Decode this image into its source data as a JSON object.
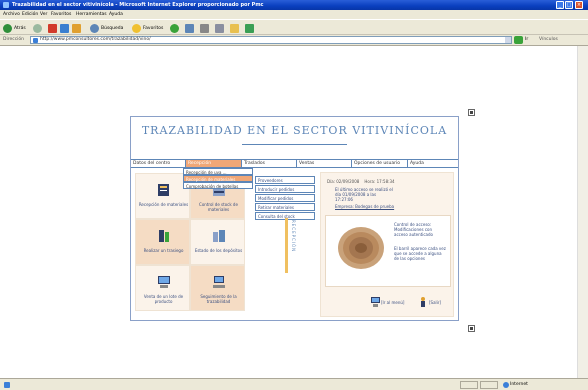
{
  "window": {
    "title": "Trazabilidad en el sector vitivinícola - Microsoft Internet Explorer proporcionado por Pmc",
    "controls": {
      "minimize": "_",
      "maximize": "□",
      "close": "×"
    }
  },
  "menu": [
    "Archivo",
    "Edición",
    "Ver",
    "Favoritos",
    "Herramientas",
    "Ayuda"
  ],
  "toolbar": {
    "back": "Atrás",
    "search": "Búsqueda",
    "favorites": "Favoritos"
  },
  "address": {
    "label": "Dirección",
    "url": "http://www.pmconsultores.com/trazabilidad/vino/",
    "go": "Ir",
    "links": "Vínculos"
  },
  "app": {
    "title": "TRAZABILIDAD EN EL SECTOR VITIVINÍCOLA",
    "nav": [
      "Datos del centro",
      "Recepción",
      "Traslados",
      "Ventas",
      "Opciones de usuario",
      "Ayuda"
    ],
    "recepcion_menu": [
      "Recepción de uva ...",
      "Recepción de materiales",
      "Comprobación de botellas"
    ],
    "submenu": [
      "Proveedores",
      "Introducir pedidos",
      "Modificar pedidos",
      "Retirar materiales",
      "Consulta del stock"
    ],
    "tiles": [
      {
        "label": "Recepción de materiales",
        "icon": "book-icon"
      },
      {
        "label": "Control de stock de materiales",
        "icon": "shelf-icon"
      },
      {
        "label": "Realizar un trasiego",
        "icon": "tank-icon"
      },
      {
        "label": "Estado de los depósitos",
        "icon": "factory-icon"
      },
      {
        "label": "Venta de un lote de producto",
        "icon": "computer-icon"
      },
      {
        "label": "Seguimiento de la trazabilidad",
        "icon": "network-icon"
      }
    ],
    "vertical_label": "RECEPCIÓN",
    "info": {
      "date": "Día: 02/09/2008",
      "time": "Hora: 17:58:34",
      "bullet1": "El último acceso se realizó el día 01/09/2008 a las 17:27:06",
      "bullet2": "Empresa: Bodegas de prueba",
      "bullet3": "Control de acceso: Modificaciones con acceso autenticado",
      "bullet4": "El barril aparece cada vez que se accede a alguna de las opciones"
    },
    "footer": {
      "menu_link": "[Ir al menú]",
      "exit_link": "[Salir]"
    }
  },
  "status": {
    "zone": "Internet"
  },
  "colors": {
    "accent": "#f0a777",
    "title": "#5d86b7",
    "border": "#5d86b7",
    "tile_light": "#fbf3ea",
    "tile_dark": "#f5dcc4"
  }
}
